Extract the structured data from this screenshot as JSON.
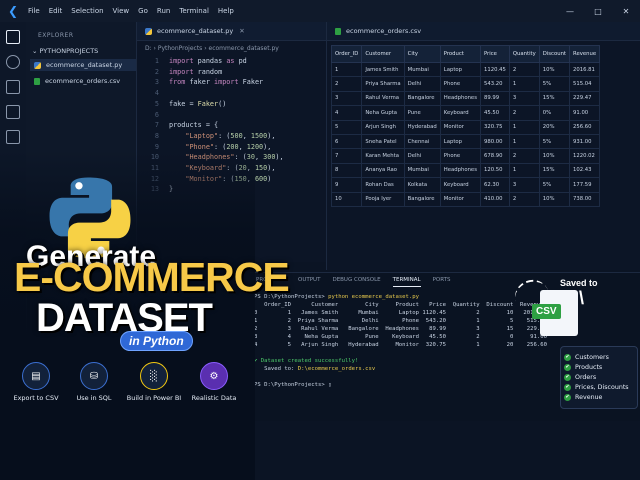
{
  "menubar": {
    "items": [
      "File",
      "Edit",
      "Selection",
      "View",
      "Go",
      "Run",
      "Terminal",
      "Help"
    ]
  },
  "explorer": {
    "title": "EXPLORER",
    "project": "PYTHONPROJECTS",
    "files": [
      "ecommerce_dataset.py",
      "ecommerce_orders.csv"
    ]
  },
  "editor": {
    "tab": "ecommerce_dataset.py",
    "breadcrumb": "D: › PythonProjects › ecommerce_dataset.py",
    "lines": [
      {
        "n": "1",
        "t": "import pandas as pd"
      },
      {
        "n": "2",
        "t": "import random"
      },
      {
        "n": "3",
        "t": "from faker import Faker"
      },
      {
        "n": "4",
        "t": ""
      },
      {
        "n": "5",
        "t": "fake = Faker()"
      },
      {
        "n": "6",
        "t": ""
      },
      {
        "n": "7",
        "t": "products = {"
      },
      {
        "n": "8",
        "t": "    \"Laptop\": (500, 1500),"
      },
      {
        "n": "9",
        "t": "    \"Phone\": (200, 1200),"
      },
      {
        "n": "10",
        "t": "    \"Headphones\": (30, 300),"
      },
      {
        "n": "11",
        "t": "    \"Keyboard\": (20, 150),"
      },
      {
        "n": "12",
        "t": "    \"Monitor\": (150, 600)"
      },
      {
        "n": "13",
        "t": "}"
      }
    ]
  },
  "csv": {
    "tab": "ecommerce_orders.csv",
    "headers": [
      "Order_ID",
      "Customer",
      "City",
      "Product",
      "Price",
      "Quantity",
      "Discount",
      "Revenue"
    ],
    "rows": [
      [
        "1",
        "James Smith",
        "Mumbai",
        "Laptop",
        "1120.45",
        "2",
        "10%",
        "2016.81"
      ],
      [
        "2",
        "Priya Sharma",
        "Delhi",
        "Phone",
        "543.20",
        "1",
        "5%",
        "515.04"
      ],
      [
        "3",
        "Rahul Verma",
        "Bangalore",
        "Headphones",
        "89.99",
        "3",
        "15%",
        "229.47"
      ],
      [
        "4",
        "Neha Gupta",
        "Pune",
        "Keyboard",
        "45.50",
        "2",
        "0%",
        "91.00"
      ],
      [
        "5",
        "Arjun Singh",
        "Hyderabad",
        "Monitor",
        "320.75",
        "1",
        "20%",
        "256.60"
      ],
      [
        "6",
        "Sneha Patel",
        "Chennai",
        "Laptop",
        "980.00",
        "1",
        "5%",
        "931.00"
      ],
      [
        "7",
        "Karan Mehta",
        "Delhi",
        "Phone",
        "678.90",
        "2",
        "10%",
        "1220.02"
      ],
      [
        "8",
        "Ananya Rao",
        "Mumbai",
        "Headphones",
        "120.50",
        "1",
        "15%",
        "102.43"
      ],
      [
        "9",
        "Rohan Das",
        "Kolkata",
        "Keyboard",
        "62.30",
        "3",
        "5%",
        "177.59"
      ],
      [
        "10",
        "Pooja Iyer",
        "Bangalore",
        "Monitor",
        "410.00",
        "2",
        "10%",
        "738.00"
      ]
    ]
  },
  "terminal": {
    "tabs": [
      "PROBLEMS",
      "OUTPUT",
      "DEBUG CONSOLE",
      "TERMINAL",
      "PORTS"
    ],
    "prompt1": "PS D:\\PythonProjects> ",
    "command": "python ecommerce_dataset.py",
    "header": "   Order_ID      Customer        City     Product   Price  Quantity  Discount  Revenue",
    "rows": [
      "0         1   James Smith      Mumbai      Laptop 1120.45         2        10   2016.81",
      "1         2  Priya Sharma       Delhi       Phone  543.20         1         5    515.04",
      "2         3   Rahul Verma   Bangalore  Headphones   89.99         3        15    229.47",
      "3         4    Neha Gupta        Pune    Keyboard   45.50         2         0     91.00",
      "4         5   Arjun Singh   Hyderabad     Monitor  320.75         1        20    256.60"
    ],
    "success": "Dataset created successfully!",
    "saved_to_label": "Saved to: ",
    "saved_path": "D:\\ecommerce_orders.csv",
    "prompt2": "PS D:\\PythonProjects> "
  },
  "overlay": {
    "line1": "Generate",
    "line2": "E-COMMERCE",
    "line3": "DATASET",
    "badge": "in Python",
    "features": [
      "Export to CSV",
      "Use in SQL",
      "Build in Power BI",
      "Realistic Data"
    ],
    "saved_small": "Saved to",
    "saved_big": "D:\\",
    "csv_tag": "CSV",
    "checklist": [
      "Customers",
      "Products",
      "Orders",
      "Prices, Discounts",
      "Revenue"
    ]
  },
  "colors": {
    "accent": "#f7c948",
    "brand": "#2f68d6",
    "success": "#2ea043"
  }
}
